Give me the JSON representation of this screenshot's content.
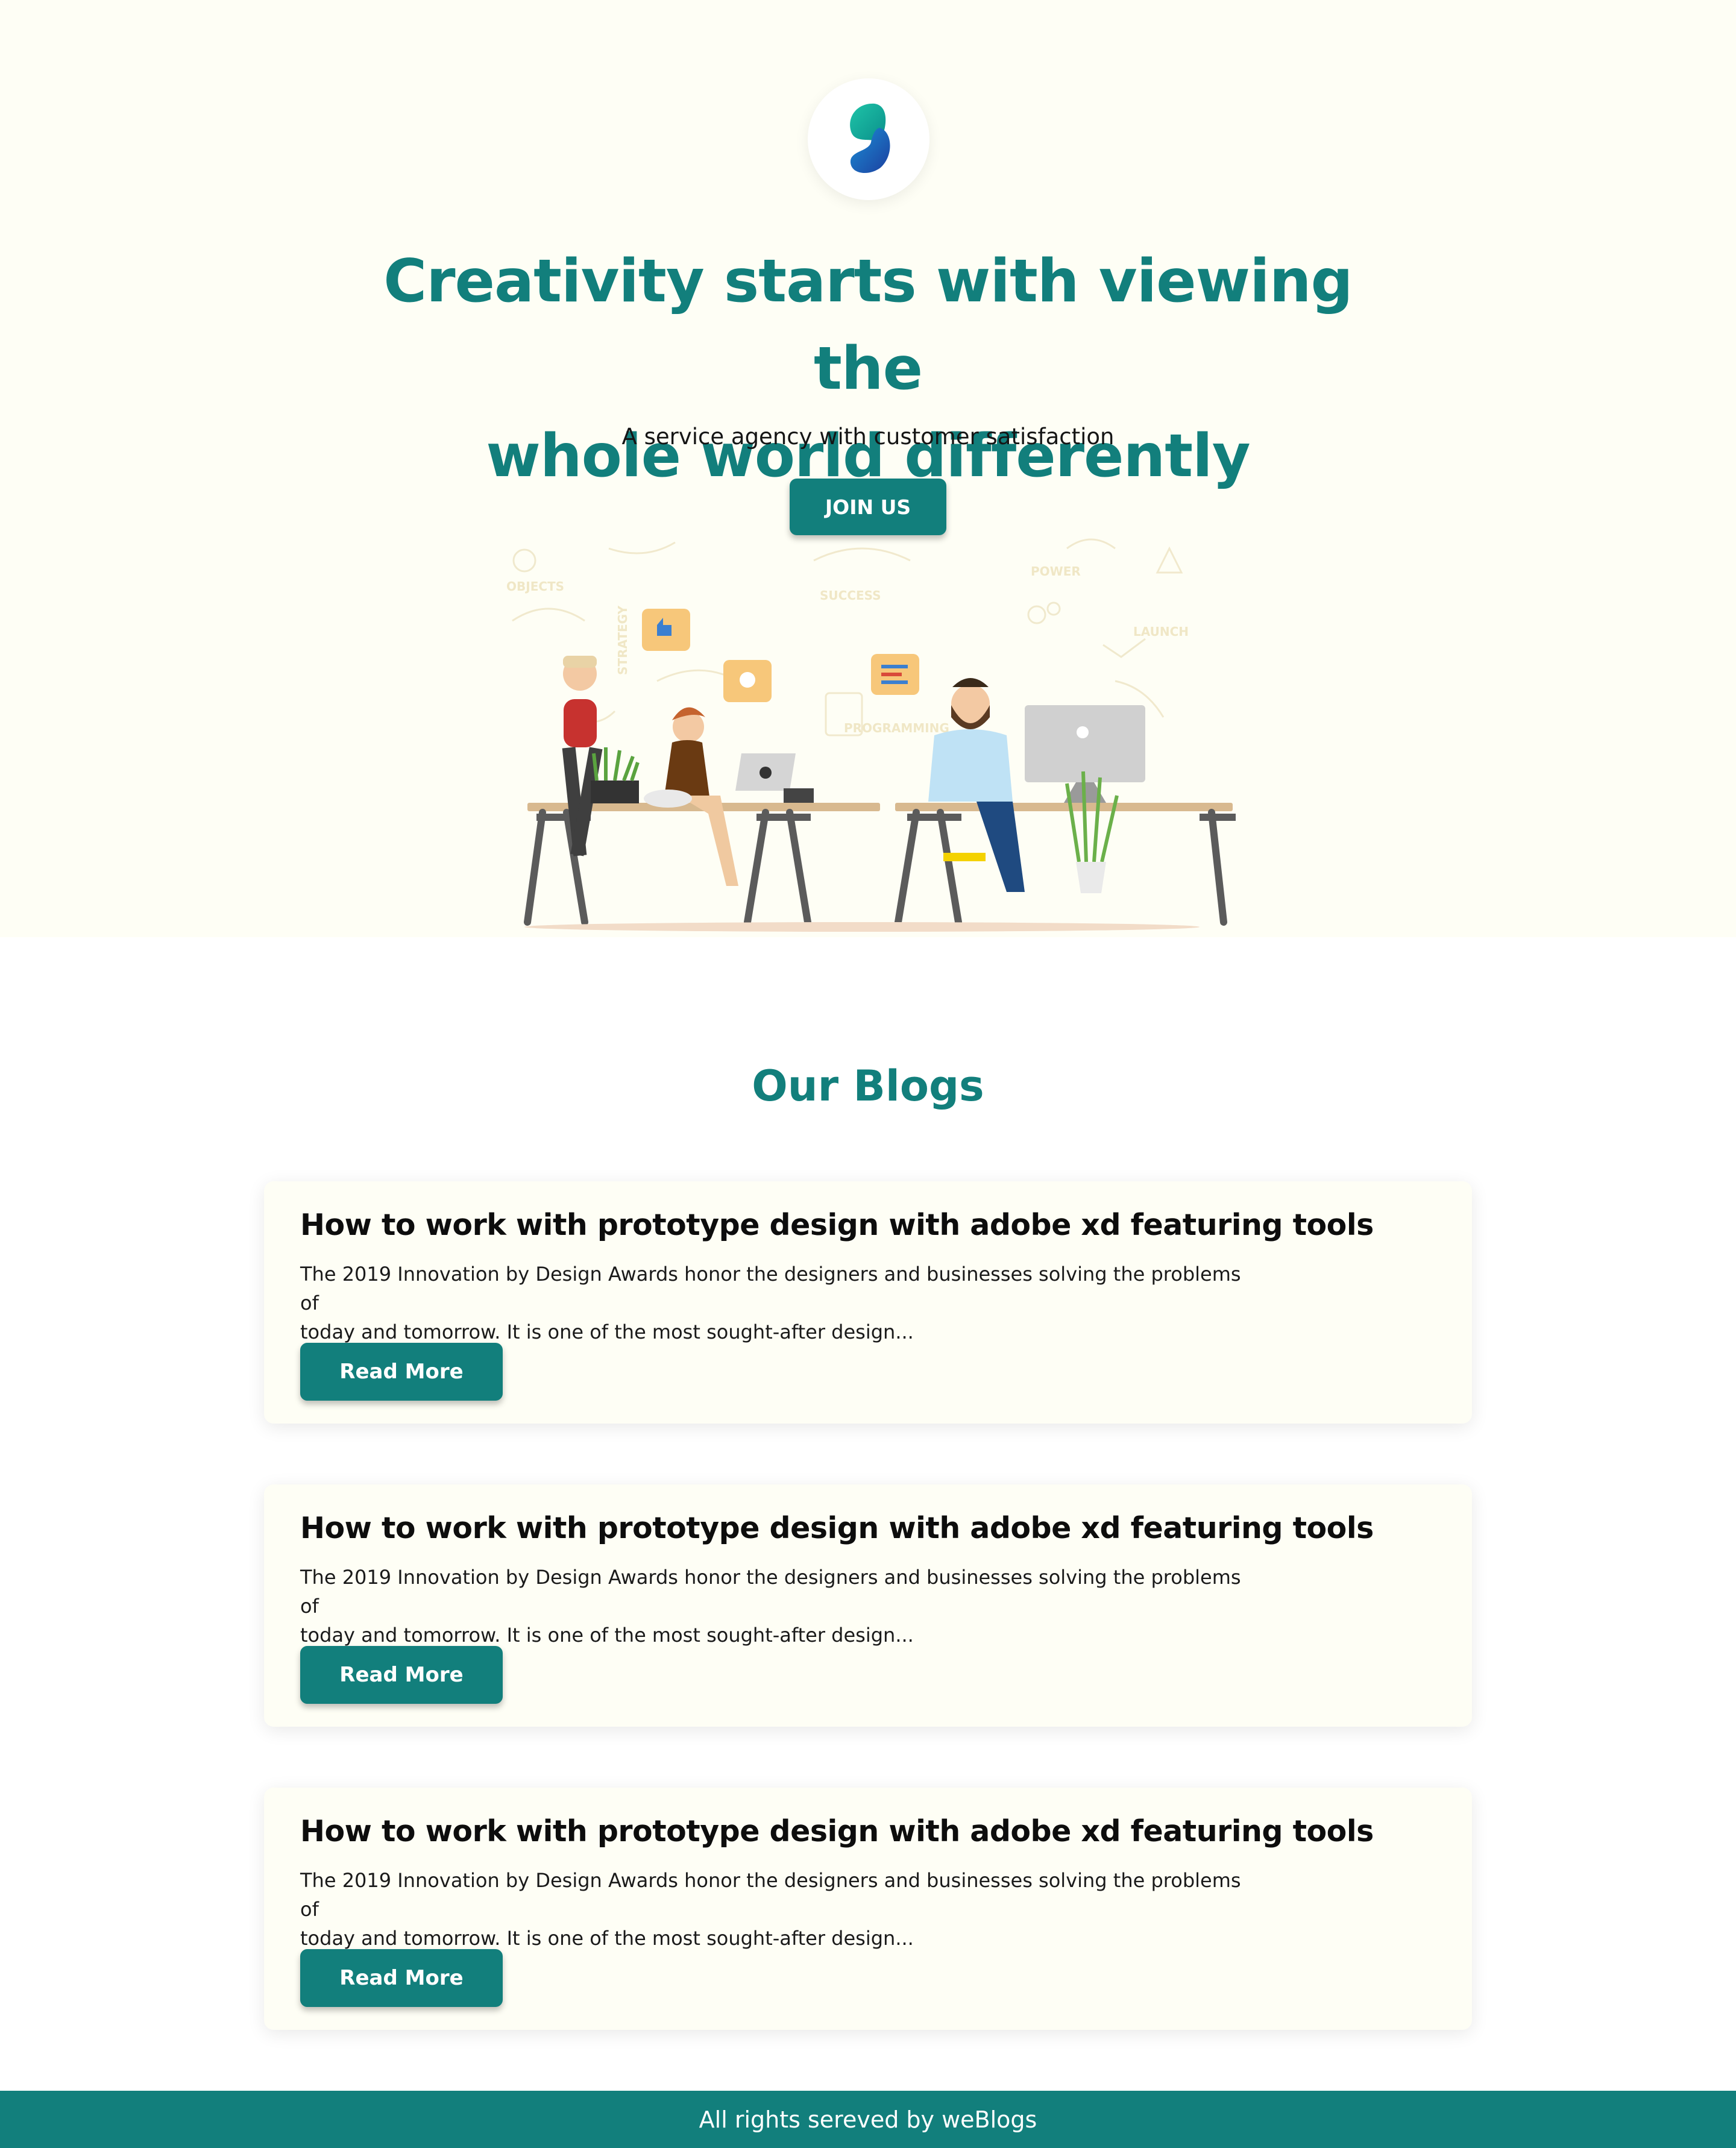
{
  "hero": {
    "logo_icon": "brand-logo-icon",
    "title_line1": "Creativity starts with viewing the",
    "title_line2": "whole world differently",
    "subtitle": "A service agency with customer satisfaction",
    "join_label": "JOIN US",
    "illustration_icon": "office-team-illustration",
    "illustration_labels": [
      "OBJECTS",
      "SUCCESS",
      "POWER",
      "LAUNCH",
      "STRATEGY",
      "PROGRAMMING"
    ]
  },
  "blogs": {
    "heading": "Our Blogs",
    "posts": [
      {
        "title": "How to work with prototype design with adobe xd featuring tools",
        "excerpt_line1": "The 2019 Innovation by Design Awards honor the designers and businesses solving the problems of",
        "excerpt_line2": "today and tomorrow. It is one of the most sought-after design...",
        "button_label": "Read More"
      },
      {
        "title": "How to work with prototype design with adobe xd featuring tools",
        "excerpt_line1": "The 2019 Innovation by Design Awards honor the designers and businesses solving the problems of",
        "excerpt_line2": "today and tomorrow. It is one of the most sought-after design...",
        "button_label": "Read More"
      },
      {
        "title": "How to work with prototype design with adobe xd featuring tools",
        "excerpt_line1": "The 2019 Innovation by Design Awards honor the designers and businesses solving the problems of",
        "excerpt_line2": "today and tomorrow. It is one of the most sought-after design...",
        "button_label": "Read More"
      }
    ]
  },
  "footer": {
    "text": "All rights sereved by weBlogs"
  },
  "colors": {
    "accent": "#127f7c",
    "hero_background": "#fefef5",
    "card_background": "#fefef5",
    "page_background": "#ffffff"
  }
}
